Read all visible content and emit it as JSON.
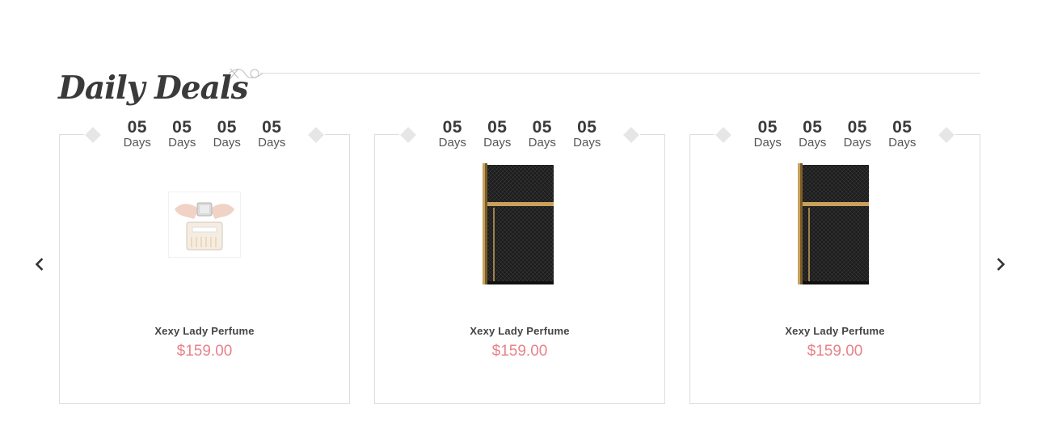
{
  "section": {
    "title": "Daily Deals"
  },
  "colors": {
    "price": "#e8838a",
    "border": "#dddddd",
    "diamond": "#e6e6e6",
    "text_dark": "#3a3a3a"
  },
  "navigation": {
    "prev_icon": "chevron-left-icon",
    "next_icon": "chevron-right-icon"
  },
  "products": [
    {
      "name": "Xexy Lady Perfume",
      "price": "$159.00",
      "image": "pink-bow-perfume-bottle",
      "countdown": [
        {
          "value": "05",
          "label": "Days"
        },
        {
          "value": "05",
          "label": "Days"
        },
        {
          "value": "05",
          "label": "Days"
        },
        {
          "value": "05",
          "label": "Days"
        }
      ]
    },
    {
      "name": "Xexy Lady Perfume",
      "price": "$159.00",
      "image": "black-gold-perfume-box",
      "countdown": [
        {
          "value": "05",
          "label": "Days"
        },
        {
          "value": "05",
          "label": "Days"
        },
        {
          "value": "05",
          "label": "Days"
        },
        {
          "value": "05",
          "label": "Days"
        }
      ]
    },
    {
      "name": "Xexy Lady Perfume",
      "price": "$159.00",
      "image": "black-gold-perfume-box",
      "countdown": [
        {
          "value": "05",
          "label": "Days"
        },
        {
          "value": "05",
          "label": "Days"
        },
        {
          "value": "05",
          "label": "Days"
        },
        {
          "value": "05",
          "label": "Days"
        }
      ]
    }
  ]
}
